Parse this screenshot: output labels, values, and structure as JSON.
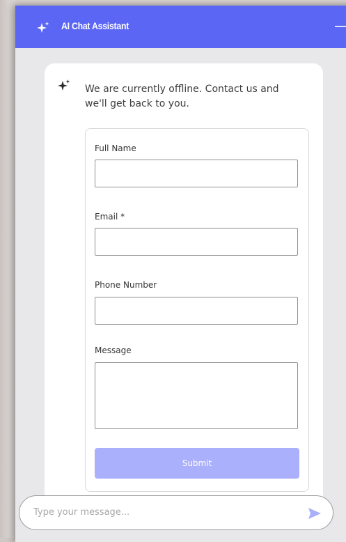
{
  "header": {
    "title": "AI Chat Assistant",
    "icon": "sparkle-icon",
    "accent_color": "#5b66f4"
  },
  "message": {
    "icon": "sparkle-icon",
    "text": "We are currently offline. Contact us and we'll get back to you."
  },
  "form": {
    "fields": [
      {
        "label": "Full Name",
        "value": ""
      },
      {
        "label": "Email *",
        "value": ""
      },
      {
        "label": "Phone Number",
        "value": ""
      },
      {
        "label": "Message",
        "value": ""
      }
    ],
    "submit_label": "Submit",
    "submit_color": "#aab0fb"
  },
  "composer": {
    "placeholder": "Type your message...",
    "send_icon": "send-icon"
  }
}
